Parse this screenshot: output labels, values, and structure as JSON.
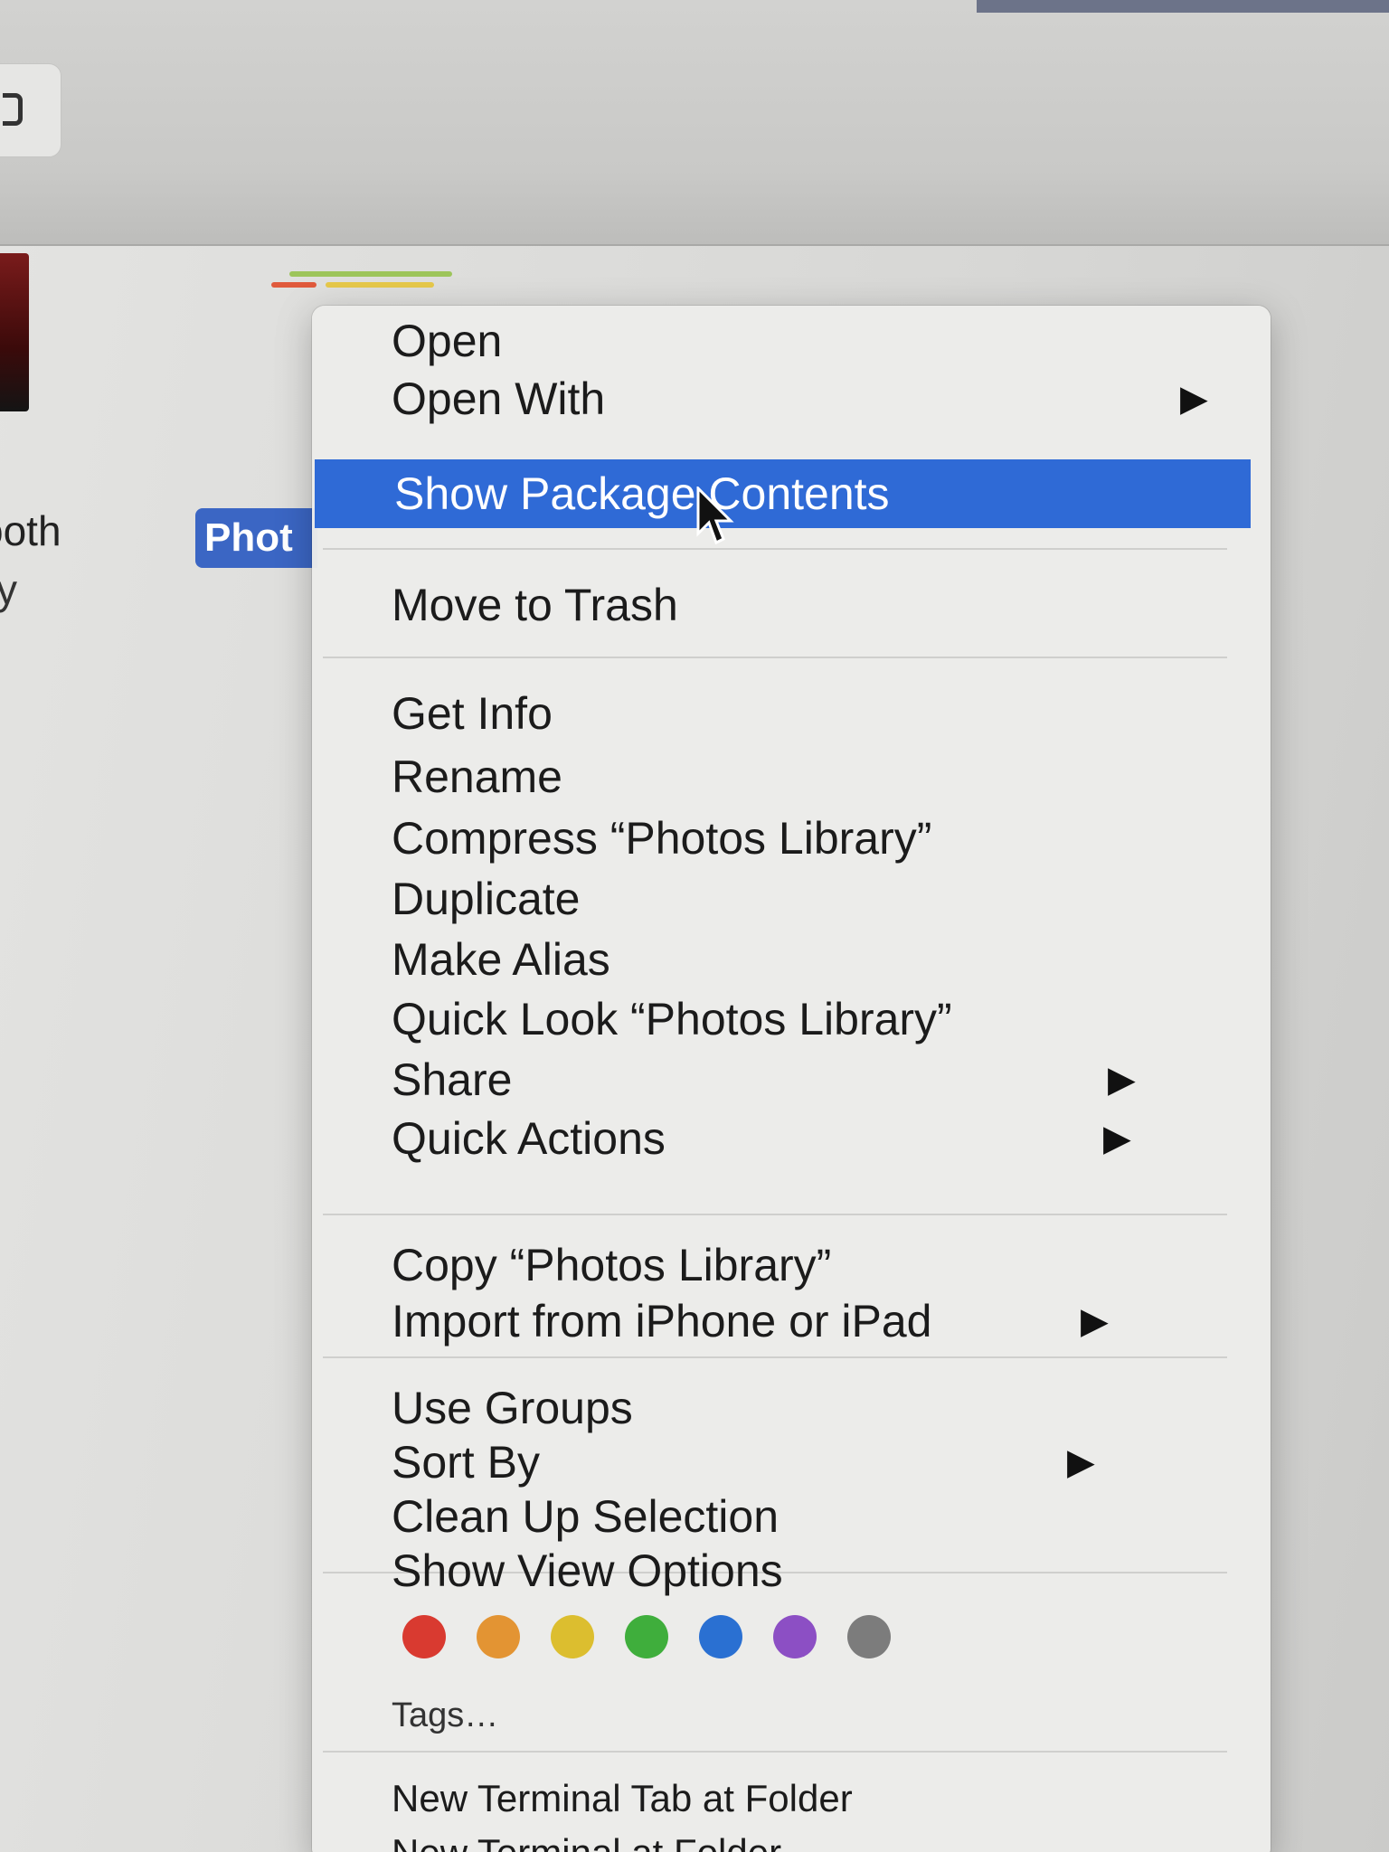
{
  "background": {
    "left_label_1": "ooth",
    "left_label_2": "y",
    "selected_file_label": "Phot"
  },
  "context_menu": {
    "items": [
      {
        "label": "Open",
        "has_submenu": false,
        "highlighted": false
      },
      {
        "label": "Open With",
        "has_submenu": true,
        "highlighted": false
      },
      {
        "label": "Show Package Contents",
        "has_submenu": false,
        "highlighted": true
      },
      {
        "label": "Move to Trash",
        "has_submenu": false,
        "highlighted": false
      },
      {
        "label": "Get Info",
        "has_submenu": false,
        "highlighted": false
      },
      {
        "label": "Rename",
        "has_submenu": false,
        "highlighted": false
      },
      {
        "label": "Compress “Photos Library”",
        "has_submenu": false,
        "highlighted": false
      },
      {
        "label": "Duplicate",
        "has_submenu": false,
        "highlighted": false
      },
      {
        "label": "Make Alias",
        "has_submenu": false,
        "highlighted": false
      },
      {
        "label": "Quick Look “Photos Library”",
        "has_submenu": false,
        "highlighted": false
      },
      {
        "label": "Share",
        "has_submenu": true,
        "highlighted": false
      },
      {
        "label": "Quick Actions",
        "has_submenu": true,
        "highlighted": false
      },
      {
        "label": "Copy “Photos Library”",
        "has_submenu": false,
        "highlighted": false
      },
      {
        "label": "Import from iPhone or iPad",
        "has_submenu": true,
        "highlighted": false
      },
      {
        "label": "Use Groups",
        "has_submenu": false,
        "highlighted": false
      },
      {
        "label": "Sort By",
        "has_submenu": true,
        "highlighted": false
      },
      {
        "label": "Clean Up Selection",
        "has_submenu": false,
        "highlighted": false
      },
      {
        "label": "Show View Options",
        "has_submenu": false,
        "highlighted": false
      },
      {
        "label": "Tags…",
        "has_submenu": false,
        "highlighted": false
      },
      {
        "label": "New Terminal Tab at Folder",
        "has_submenu": false,
        "highlighted": false
      },
      {
        "label": "New Terminal at Folder",
        "has_submenu": false,
        "highlighted": false
      }
    ],
    "submenu_arrow": "▶",
    "tag_colors": [
      {
        "name": "red",
        "color": "#d93a30"
      },
      {
        "name": "orange",
        "color": "#e39433"
      },
      {
        "name": "yellow",
        "color": "#dcbe2f"
      },
      {
        "name": "green",
        "color": "#3fae3c"
      },
      {
        "name": "blue",
        "color": "#2a70d2"
      },
      {
        "name": "purple",
        "color": "#8c4fc4"
      },
      {
        "name": "gray",
        "color": "#7c7c7c"
      }
    ],
    "highlight_color": "#2f6ad6"
  }
}
